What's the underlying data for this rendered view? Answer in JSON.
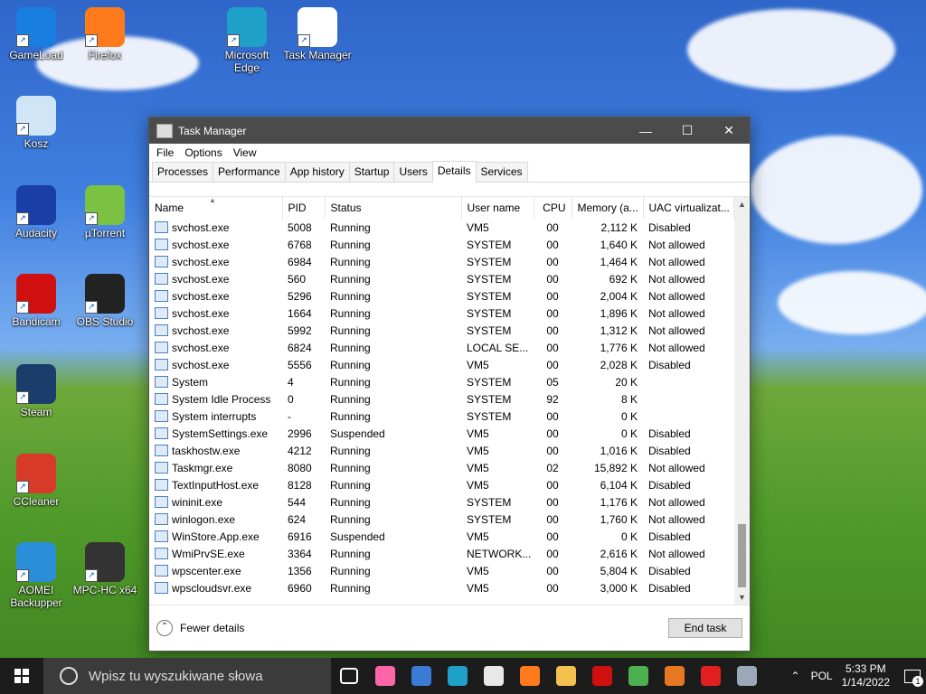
{
  "desktop_icons": [
    {
      "label": "GameLoad",
      "color": "#1a7de0"
    },
    {
      "label": "Firefox",
      "color": "#ff7a1a"
    },
    {
      "label": "Microsoft Edge",
      "color": "#1fa0c8"
    },
    {
      "label": "Task Manager",
      "color": "#ffffff"
    },
    {
      "label": "Kosz",
      "color": "#d0e6f7"
    },
    {
      "label": "Audacity",
      "color": "#1b3fa8"
    },
    {
      "label": "µTorrent",
      "color": "#7cc242"
    },
    {
      "label": "Bandicam",
      "color": "#d01010"
    },
    {
      "label": "OBS Studio",
      "color": "#222222"
    },
    {
      "label": "Steam",
      "color": "#1b3d6b"
    },
    {
      "label": "CCleaner",
      "color": "#d83a2a"
    },
    {
      "label": "AOMEI Backupper",
      "color": "#2a8ed8"
    },
    {
      "label": "MPC-HC x64",
      "color": "#333333"
    }
  ],
  "window": {
    "title": "Task Manager",
    "menu": [
      "File",
      "Options",
      "View"
    ],
    "tabs": [
      "Processes",
      "Performance",
      "App history",
      "Startup",
      "Users",
      "Details",
      "Services"
    ],
    "active_tab": "Details",
    "columns": [
      "Name",
      "PID",
      "Status",
      "User name",
      "CPU",
      "Memory (a...",
      "UAC virtualizat..."
    ],
    "rows": [
      [
        "svchost.exe",
        "5008",
        "Running",
        "VM5",
        "00",
        "2,112 K",
        "Disabled"
      ],
      [
        "svchost.exe",
        "6768",
        "Running",
        "SYSTEM",
        "00",
        "1,640 K",
        "Not allowed"
      ],
      [
        "svchost.exe",
        "6984",
        "Running",
        "SYSTEM",
        "00",
        "1,464 K",
        "Not allowed"
      ],
      [
        "svchost.exe",
        "560",
        "Running",
        "SYSTEM",
        "00",
        "692 K",
        "Not allowed"
      ],
      [
        "svchost.exe",
        "5296",
        "Running",
        "SYSTEM",
        "00",
        "2,004 K",
        "Not allowed"
      ],
      [
        "svchost.exe",
        "1664",
        "Running",
        "SYSTEM",
        "00",
        "1,896 K",
        "Not allowed"
      ],
      [
        "svchost.exe",
        "5992",
        "Running",
        "SYSTEM",
        "00",
        "1,312 K",
        "Not allowed"
      ],
      [
        "svchost.exe",
        "6824",
        "Running",
        "LOCAL SE...",
        "00",
        "1,776 K",
        "Not allowed"
      ],
      [
        "svchost.exe",
        "5556",
        "Running",
        "VM5",
        "00",
        "2,028 K",
        "Disabled"
      ],
      [
        "System",
        "4",
        "Running",
        "SYSTEM",
        "05",
        "20 K",
        ""
      ],
      [
        "System Idle Process",
        "0",
        "Running",
        "SYSTEM",
        "92",
        "8 K",
        ""
      ],
      [
        "System interrupts",
        "-",
        "Running",
        "SYSTEM",
        "00",
        "0 K",
        ""
      ],
      [
        "SystemSettings.exe",
        "2996",
        "Suspended",
        "VM5",
        "00",
        "0 K",
        "Disabled"
      ],
      [
        "taskhostw.exe",
        "4212",
        "Running",
        "VM5",
        "00",
        "1,016 K",
        "Disabled"
      ],
      [
        "Taskmgr.exe",
        "8080",
        "Running",
        "VM5",
        "02",
        "15,892 K",
        "Not allowed"
      ],
      [
        "TextInputHost.exe",
        "8128",
        "Running",
        "VM5",
        "00",
        "6,104 K",
        "Disabled"
      ],
      [
        "wininit.exe",
        "544",
        "Running",
        "SYSTEM",
        "00",
        "1,176 K",
        "Not allowed"
      ],
      [
        "winlogon.exe",
        "624",
        "Running",
        "SYSTEM",
        "00",
        "1,760 K",
        "Not allowed"
      ],
      [
        "WinStore.App.exe",
        "6916",
        "Suspended",
        "VM5",
        "00",
        "0 K",
        "Disabled"
      ],
      [
        "WmiPrvSE.exe",
        "3364",
        "Running",
        "NETWORK...",
        "00",
        "2,616 K",
        "Not allowed"
      ],
      [
        "wpscenter.exe",
        "1356",
        "Running",
        "VM5",
        "00",
        "5,804 K",
        "Disabled"
      ],
      [
        "wpscloudsvr.exe",
        "6960",
        "Running",
        "VM5",
        "00",
        "3,000 K",
        "Disabled"
      ]
    ],
    "fewer_details": "Fewer details",
    "end_task": "End task"
  },
  "taskbar": {
    "search_placeholder": "Wpisz tu wyszukiwane słowa",
    "language": "POL",
    "time": "5:33 PM",
    "date": "1/14/2022",
    "notification_count": "1",
    "apps": [
      {
        "name": "task-view",
        "color": "#1c1c1c"
      },
      {
        "name": "osu",
        "color": "#ff66aa"
      },
      {
        "name": "store",
        "color": "#3a7bd5"
      },
      {
        "name": "edge",
        "color": "#1fa0c8"
      },
      {
        "name": "mail",
        "color": "#e8e8e8"
      },
      {
        "name": "firefox",
        "color": "#ff7a1a"
      },
      {
        "name": "file-explorer",
        "color": "#f2c14e"
      },
      {
        "name": "bandicam",
        "color": "#d01010"
      },
      {
        "name": "chrome",
        "color": "#4caf50"
      },
      {
        "name": "media-player",
        "color": "#e87722"
      },
      {
        "name": "wps",
        "color": "#e02020"
      },
      {
        "name": "task-manager",
        "color": "#9aa8b8"
      }
    ]
  }
}
